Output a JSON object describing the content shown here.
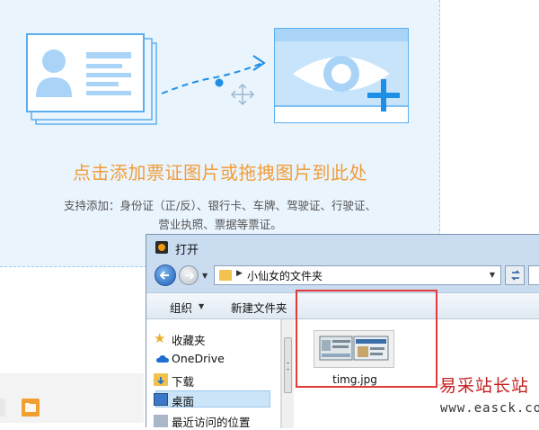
{
  "upload": {
    "title": "点击添加票证图片或拖拽图片到此处",
    "description_line1": "支持添加：身份证（正/反）、银行卡、车牌、驾驶证、行驶证、",
    "description_line2": "营业执照、票据等票证。"
  },
  "dialog": {
    "title": "打开",
    "address": {
      "path_label": "小仙女的文件夹"
    },
    "toolbar": {
      "organize_label": "组织",
      "new_folder_label": "新建文件夹"
    },
    "nav": {
      "items": [
        {
          "label": "收藏夹",
          "icon": "star-icon"
        },
        {
          "label": "OneDrive",
          "icon": "cloud-icon"
        },
        {
          "label": "下载",
          "icon": "download-folder-icon"
        },
        {
          "label": "桌面",
          "icon": "desktop-icon",
          "selected": true
        },
        {
          "label": "最近访问的位置",
          "icon": "recent-places-icon"
        }
      ]
    },
    "files": [
      {
        "name": "timg.jpg",
        "type": "image"
      }
    ]
  },
  "watermark": {
    "brand": "易采站长站",
    "url": "www.easck.com"
  },
  "colors": {
    "accent_orange": "#f19d3a",
    "panel_blue": "#e9f4fd",
    "illustration_blue": "#5aaef0",
    "highlight_red": "#e03a3a"
  }
}
